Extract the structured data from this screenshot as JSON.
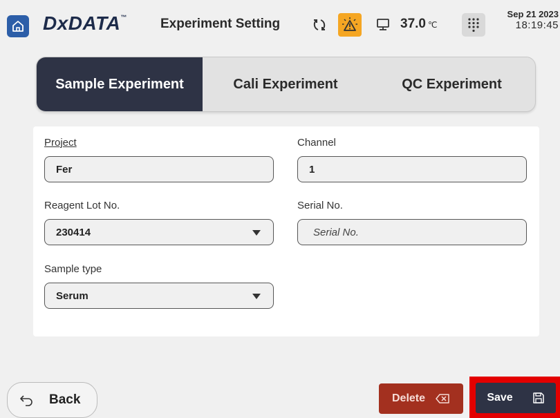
{
  "header": {
    "brand": "DxDATA",
    "brand_tm": "™",
    "title": "Experiment Setting",
    "temperature": "37.0",
    "temperature_unit": "℃",
    "date": "Sep 21 2023",
    "time": "18:19:45",
    "alarm_color": "#f5a623",
    "home_color": "#2c5ea8"
  },
  "tabs": [
    {
      "label": "Sample Experiment",
      "active": true
    },
    {
      "label": "Cali Experiment",
      "active": false
    },
    {
      "label": "QC Experiment",
      "active": false
    }
  ],
  "form": {
    "project": {
      "label": "Project",
      "value": "Fer"
    },
    "channel": {
      "label": "Channel",
      "value": "1"
    },
    "reagent_lot": {
      "label": "Reagent Lot No.",
      "value": "230414"
    },
    "serial_no": {
      "label": "Serial No.",
      "placeholder": "Serial No."
    },
    "sample_type": {
      "label": "Sample type",
      "value": "Serum"
    }
  },
  "buttons": {
    "back": "Back",
    "delete": "Delete",
    "save": "Save"
  }
}
